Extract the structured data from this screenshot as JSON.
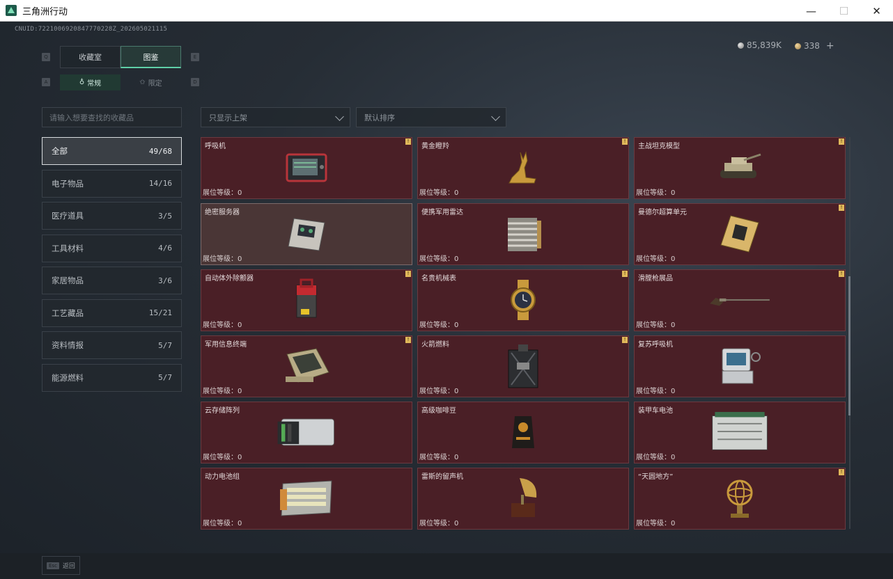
{
  "window": {
    "title": "三角洲行动",
    "minimize_glyph": "—",
    "maximize_glyph": "☐",
    "close_glyph": "✕"
  },
  "header": {
    "uid": "CNUID:7221006920847770228Z_202605021115",
    "currency": [
      {
        "icon": "silver-coin-icon",
        "value": "85,839K"
      },
      {
        "icon": "gold-coin-icon",
        "value": "338"
      }
    ],
    "add_glyph": "+"
  },
  "key_hints": {
    "tab_prev": "Q",
    "tab_next": "E",
    "sub_prev": "A",
    "sub_next": "D"
  },
  "tabs": [
    {
      "label": "收藏室",
      "active": false
    },
    {
      "label": "图鉴",
      "active": true
    }
  ],
  "subtabs": [
    {
      "label": "常规",
      "icon": "flame-icon",
      "active": true
    },
    {
      "label": "限定",
      "icon": "star-icon",
      "active": false
    }
  ],
  "search": {
    "placeholder": "请输入想要查找的收藏品"
  },
  "filters": {
    "availability": "只显示上架",
    "sort": "默认排序"
  },
  "categories": [
    {
      "label": "全部",
      "count": "49/68",
      "active": true
    },
    {
      "label": "电子物品",
      "count": "14/16"
    },
    {
      "label": "医疗道具",
      "count": "3/5"
    },
    {
      "label": "工具材料",
      "count": "4/6"
    },
    {
      "label": "家居物品",
      "count": "3/6"
    },
    {
      "label": "工艺藏品",
      "count": "15/21"
    },
    {
      "label": "资料情报",
      "count": "5/7"
    },
    {
      "label": "能源燃料",
      "count": "5/7"
    }
  ],
  "level_label": "展位等级：",
  "flag_glyph": "!",
  "items": [
    {
      "name": "呼吸机",
      "level": "0",
      "flag": true,
      "icon": "respirator-icon"
    },
    {
      "name": "黄金瞪羚",
      "level": "0",
      "flag": true,
      "icon": "golden-gazelle-icon"
    },
    {
      "name": "主战坦克模型",
      "level": "0",
      "flag": true,
      "icon": "tank-model-icon"
    },
    {
      "name": "绝密服务器",
      "level": "0",
      "flag": false,
      "icon": "server-icon",
      "selected": true
    },
    {
      "name": "便携军用雷达",
      "level": "0",
      "flag": false,
      "icon": "radar-icon"
    },
    {
      "name": "曼德尔超算单元",
      "level": "0",
      "flag": true,
      "icon": "supercomputer-icon"
    },
    {
      "name": "自动体外除颤器",
      "level": "0",
      "flag": true,
      "icon": "defibrillator-icon"
    },
    {
      "name": "名贵机械表",
      "level": "0",
      "flag": true,
      "icon": "watch-icon"
    },
    {
      "name": "滑膛枪展品",
      "level": "0",
      "flag": true,
      "icon": "musket-icon"
    },
    {
      "name": "军用信息终端",
      "level": "0",
      "flag": true,
      "icon": "terminal-icon"
    },
    {
      "name": "火箭燃料",
      "level": "0",
      "flag": true,
      "icon": "fuel-can-icon"
    },
    {
      "name": "复苏呼吸机",
      "level": "0",
      "flag": false,
      "icon": "resuscitator-icon"
    },
    {
      "name": "云存储阵列",
      "level": "0",
      "flag": false,
      "icon": "storage-array-icon"
    },
    {
      "name": "高级咖啡豆",
      "level": "0",
      "flag": false,
      "icon": "coffee-bag-icon"
    },
    {
      "name": "装甲车电池",
      "level": "0",
      "flag": false,
      "icon": "battery-icon"
    },
    {
      "name": "动力电池组",
      "level": "0",
      "flag": false,
      "icon": "battery-pack-icon"
    },
    {
      "name": "雷斯的留声机",
      "level": "0",
      "flag": false,
      "icon": "gramophone-icon"
    },
    {
      "name": "“天圆地方”",
      "level": "0",
      "flag": true,
      "icon": "armillary-sphere-icon"
    }
  ],
  "footer": {
    "esc_key": "Esc",
    "back_label": "返回"
  }
}
